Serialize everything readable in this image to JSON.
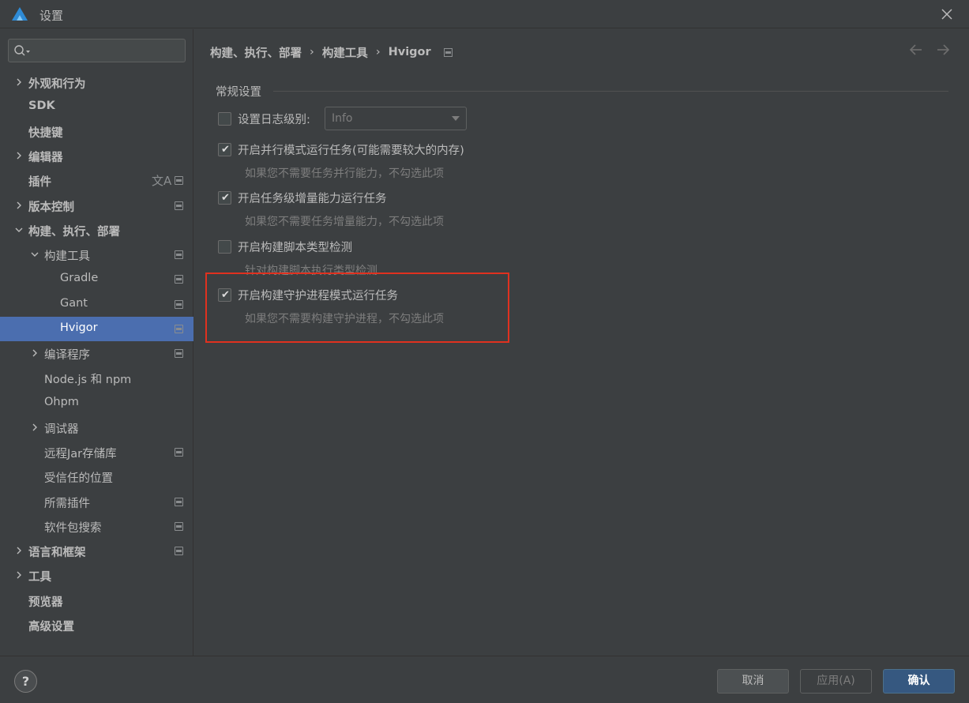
{
  "window": {
    "title": "设置"
  },
  "search": {
    "placeholder": ""
  },
  "sidebar": {
    "items": [
      {
        "label": "外观和行为",
        "expandable": true,
        "expanded": false
      },
      {
        "label": "SDK"
      },
      {
        "label": "快捷键"
      },
      {
        "label": "编辑器",
        "expandable": true,
        "expanded": false
      },
      {
        "label": "插件"
      },
      {
        "label": "版本控制",
        "expandable": true,
        "expanded": false
      },
      {
        "label": "构建、执行、部署",
        "expandable": true,
        "expanded": true
      },
      {
        "label": "构建工具",
        "expandable": true,
        "expanded": true
      },
      {
        "label": "Gradle"
      },
      {
        "label": "Gant"
      },
      {
        "label": "Hvigor",
        "selected": true
      },
      {
        "label": "编译程序",
        "expandable": true,
        "expanded": false
      },
      {
        "label": "Node.js 和 npm"
      },
      {
        "label": "Ohpm"
      },
      {
        "label": "调试器",
        "expandable": true,
        "expanded": false
      },
      {
        "label": "远程Jar存储库"
      },
      {
        "label": "受信任的位置"
      },
      {
        "label": "所需插件"
      },
      {
        "label": "软件包搜索"
      },
      {
        "label": "语言和框架",
        "expandable": true,
        "expanded": false
      },
      {
        "label": "工具",
        "expandable": true,
        "expanded": false
      },
      {
        "label": "预览器"
      },
      {
        "label": "高级设置"
      }
    ]
  },
  "breadcrumb": {
    "part1": "构建、执行、部署",
    "part2": "构建工具",
    "part3": "Hvigor",
    "separator": "›"
  },
  "main": {
    "section_title": "常规设置",
    "log_level": {
      "label": "设置日志级别:",
      "checked": false,
      "value": "Info"
    },
    "options": [
      {
        "label": "开启并行模式运行任务(可能需要较大的内存)",
        "checked": true,
        "hint": "如果您不需要任务并行能力，不勾选此项"
      },
      {
        "label": "开启任务级增量能力运行任务",
        "checked": true,
        "hint": "如果您不需要任务增量能力，不勾选此项"
      },
      {
        "label": "开启构建脚本类型检测",
        "checked": false,
        "hint": "针对构建脚本执行类型检测"
      },
      {
        "label": "开启构建守护进程模式运行任务",
        "checked": true,
        "hint": "如果您不需要构建守护进程，不勾选此项"
      }
    ]
  },
  "footer": {
    "help": "?",
    "cancel": "取消",
    "apply": "应用(A)",
    "ok": "确认"
  },
  "colors": {
    "background": "#3c3f41",
    "selection": "#4b6eaf",
    "primary_button": "#365880",
    "highlight_border": "#e0311f"
  },
  "icons": {
    "logo": "app-logo-icon",
    "close": "close-icon",
    "search": "search-icon",
    "back": "arrow-left-icon",
    "forward": "arrow-right-icon",
    "translate": "translate-icon",
    "pin": "project-level-icon"
  }
}
